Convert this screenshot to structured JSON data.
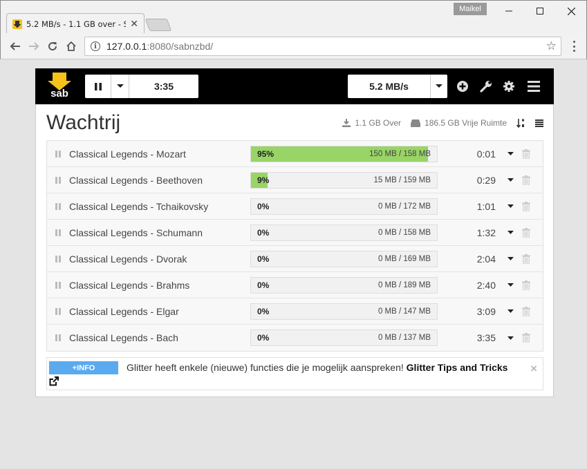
{
  "browser": {
    "tab_title": "5.2 MB/s - 1.1 GB over - S",
    "profile_name": "Maikel",
    "url_host": "127.0.0.1",
    "url_rest": ":8080/sabnzbd/"
  },
  "header": {
    "time_left": "3:35",
    "speed": "5.2 MB/s",
    "logo_text": "sab"
  },
  "page": {
    "title": "Wachtrij",
    "remaining": "1.1 GB Over",
    "free_space": "186.5 GB Vrije Ruimte"
  },
  "queue": [
    {
      "name": "Classical Legends - Mozart",
      "percent": "95%",
      "progress": 0.95,
      "size": "150 MB / 158 MB",
      "time": "0:01"
    },
    {
      "name": "Classical Legends - Beethoven",
      "percent": "9%",
      "progress": 0.09,
      "size": "15 MB / 159 MB",
      "time": "0:29"
    },
    {
      "name": "Classical Legends - Tchaikovsky",
      "percent": "0%",
      "progress": 0,
      "size": "0 MB / 172 MB",
      "time": "1:01"
    },
    {
      "name": "Classical Legends - Schumann",
      "percent": "0%",
      "progress": 0,
      "size": "0 MB / 158 MB",
      "time": "1:32"
    },
    {
      "name": "Classical Legends - Dvorak",
      "percent": "0%",
      "progress": 0,
      "size": "0 MB / 169 MB",
      "time": "2:04"
    },
    {
      "name": "Classical Legends - Brahms",
      "percent": "0%",
      "progress": 0,
      "size": "0 MB / 189 MB",
      "time": "2:40"
    },
    {
      "name": "Classical Legends - Elgar",
      "percent": "0%",
      "progress": 0,
      "size": "0 MB / 147 MB",
      "time": "3:09"
    },
    {
      "name": "Classical Legends - Bach",
      "percent": "0%",
      "progress": 0,
      "size": "0 MB / 137 MB",
      "time": "3:35"
    }
  ],
  "notice": {
    "badge": "+INFO",
    "text": "Glitter heeft enkele (nieuwe) functies die je mogelijk aanspreken! ",
    "link": "Glitter Tips and Tricks",
    "close": "×"
  },
  "colors": {
    "progress_fill": "#99d466",
    "logo_yellow": "#f6c21a",
    "info_badge": "#5aaaf0"
  }
}
